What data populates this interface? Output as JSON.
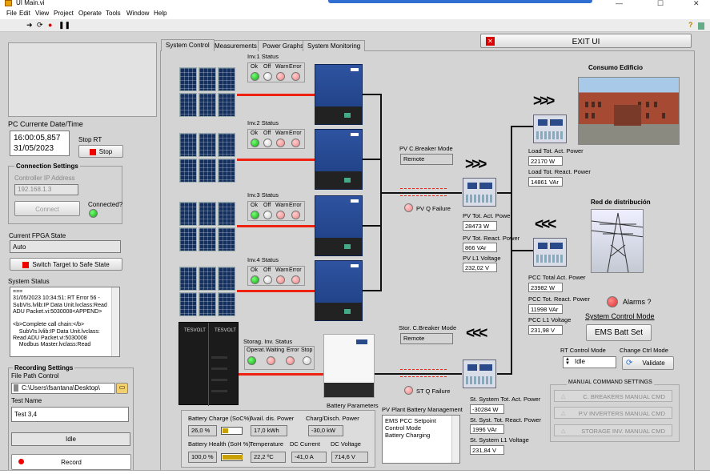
{
  "window": {
    "title": "UI Main.vi"
  },
  "menu": [
    "File",
    "Edit",
    "View",
    "Project",
    "Operate",
    "Tools",
    "Window",
    "Help"
  ],
  "help_glyph": "?",
  "toolbar_icons": [
    "run-arrow-icon",
    "run-continuous-icon",
    "abort-icon",
    "pause-icon"
  ],
  "left": {
    "datetime_label": "PC Currente Date/Time",
    "time": "16:00:05,857",
    "date": "31/05/2023",
    "stop_rt_label": "Stop RT",
    "stop_button": "Stop",
    "connection": {
      "title": "Connection Settings",
      "ip_label": "Controller IP Address",
      "ip_value": "192.168.1.3",
      "connect_button": "Connect",
      "connected_label": "Connected?"
    },
    "fpga_label": "Current FPGA State",
    "fpga_value": "Auto",
    "switch_button": "Switch Target to Safe State",
    "system_status_label": "System Status",
    "system_status_text": "===\n31/05/2023 10:34:51: RT Error 56 -\nSubVIs.lvlib:IP Data Unit.lvclass:Read\nADU Packet.vi:5030008<APPEND>\n\n<b>Complete call chain:</b>\n    SubVIs.lvlib:IP Data Unit.lvclass:\nRead ADU Packet.vi:5030008\n    Modbus Master.lvclass:Read",
    "recording": {
      "title": "Recording Settings",
      "file_path_label": "File Path Control",
      "file_path": "C:\\Users\\fsantana\\Desktop\\",
      "test_name_label": "Test Name",
      "test_name": "Test 3,4",
      "state": "Idle",
      "record_button": "Record"
    }
  },
  "tabs": [
    "System Control",
    "Measurements",
    "Power Graphs",
    "System Monitoring"
  ],
  "exit_button": "EXIT UI",
  "inverters": [
    {
      "title": "Inv.1 Status",
      "headers": [
        "Ok",
        "Off",
        "Warn",
        "Error"
      ]
    },
    {
      "title": "Inv.2 Status",
      "headers": [
        "Ok",
        "Off",
        "Warn",
        "Error"
      ]
    },
    {
      "title": "Inv.3 Status",
      "headers": [
        "Ok",
        "Off",
        "Warn",
        "Error"
      ]
    },
    {
      "title": "Inv.4 Status",
      "headers": [
        "Ok",
        "Off",
        "Warn",
        "Error"
      ]
    }
  ],
  "storage_inv": {
    "title": "Storag. Inv. Status",
    "headers": [
      "Operat.",
      "Waiting",
      "Error",
      "Stop"
    ]
  },
  "pv_breaker": {
    "label": "PV C.Breaker Mode",
    "value": "Remote",
    "failure": "PV Q Failure"
  },
  "st_breaker": {
    "label": "Stor. C.Breaker Mode",
    "value": "Remote",
    "failure": "ST Q Failure"
  },
  "pv_meter": {
    "act_label": "PV Tot. Act. Power",
    "act": "28473 W",
    "react_label": "PV Tot. React. Power",
    "react": "866 VAr",
    "volt_label": "PV L1 Voltage",
    "volt": "232,02 V"
  },
  "load": {
    "title": "Consumo Edificio",
    "act_label": "Load  Tot. Act. Power",
    "act": "22170 W",
    "react_label": "Load Tot. React. Power",
    "react": "14861 VAr"
  },
  "grid": {
    "title": "Red de distribución",
    "act_label": "PCC Total Act. Power",
    "act": "23982 W",
    "react_label": "PCC Tot. React. Power",
    "react": "11998 VAr",
    "volt_label": "PCC L1 Voltage",
    "volt": "231,98 V",
    "alarms_label": "Alarms ?"
  },
  "storage_meter": {
    "act_label": "St. System Tot. Act. Power",
    "act": "-30284 W",
    "react_label": "St. Syst. Tot. React. Power",
    "react": "1996 VAr",
    "volt_label": "St. System L1 Voltage",
    "volt": "231,84 V"
  },
  "control_mode": {
    "title": "System Control Mode",
    "ems_button": "EMS Batt Set",
    "rt_label": "RT Control Mode",
    "rt_value": "Idle",
    "change_label": "Change Ctrl Mode",
    "validate_button": "Validate"
  },
  "manual": {
    "title": "MANUAL COMMAND SETTINGS",
    "buttons": [
      "C. BREAKERS MANUAL CMD",
      "P.V INVERTERS MANUAL CMD",
      "STORAGE INV. MANUAL CMD"
    ]
  },
  "battery_brand": "TESVOLT",
  "battery_params_label": "Battery Parameters",
  "battery": {
    "soc_label": "Battery Charge (SoC%)",
    "soc": "26,0 %",
    "soc_fraction": 0.26,
    "avail_label": "Avail. dis. Power",
    "avail": "17,0 kWh",
    "chg_label": "Charg/Disch. Power",
    "chg": "-30,0 kW",
    "soh_label": "Battery Health (SoH %)",
    "soh": "100,0 %",
    "soh_fraction": 1.0,
    "temp_label": "Temperature",
    "temp": "22,2 ºC",
    "dc_i_label": "DC Current",
    "dc_i": "-41,0 A",
    "dc_v_label": "DC Voltage",
    "dc_v": "714,6 V"
  },
  "pv_batt_mgmt": {
    "label": "PV Plant Battery Management",
    "lines": "EMS PCC Setpoint\nControl Mode\nBattery Charging"
  },
  "colors": {
    "accent_red": "#e21f26",
    "led_green": "#22aa22",
    "inverter_blue": "#1d3d80"
  }
}
